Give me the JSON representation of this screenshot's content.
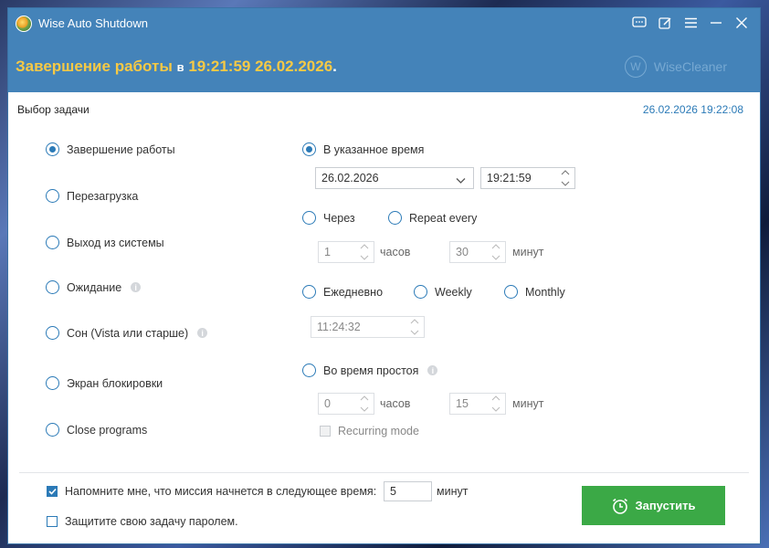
{
  "window": {
    "title": "Wise Auto Shutdown",
    "brand": "WiseCleaner",
    "brand_mark": "W"
  },
  "banner": {
    "action": "Завершение работы",
    "preposition": "в",
    "time": "19:21:59 26.02.2026",
    "period": "."
  },
  "task": {
    "section_label": "Выбор задачи",
    "current_datetime": "26.02.2026 19:22:08",
    "options": [
      {
        "label": "Завершение работы",
        "checked": true
      },
      {
        "label": "Перезагрузка",
        "checked": false
      },
      {
        "label": "Выход из системы",
        "checked": false
      },
      {
        "label": "Ожидание",
        "checked": false,
        "info": true
      },
      {
        "label": "Сон (Vista или старше)",
        "checked": false,
        "info": true
      },
      {
        "label": "Экран блокировки",
        "checked": false
      },
      {
        "label": "Close programs",
        "checked": false
      }
    ]
  },
  "schedule": {
    "specified_time_label": "В указанное время",
    "date_value": "26.02.2026",
    "time_value": "19:21:59",
    "after_label": "Через",
    "repeat_label": "Repeat every",
    "hours_value": "1",
    "hours_unit": "часов",
    "minutes_value": "30",
    "minutes_unit": "минут",
    "daily_label": "Ежедневно",
    "weekly_label": "Weekly",
    "monthly_label": "Monthly",
    "daily_time_value": "11:24:32",
    "idle_label": "Во время простоя",
    "idle_hours_value": "0",
    "idle_hours_unit": "часов",
    "idle_minutes_value": "15",
    "idle_minutes_unit": "минут",
    "recurring_label": "Recurring mode"
  },
  "footer": {
    "remind_label": "Напомните мне, что миссия начнется в следующее время:",
    "remind_value": "5",
    "remind_unit": "минут",
    "password_label": "Защитите свою задачу паролем.",
    "start_label": "Запустить"
  },
  "colors": {
    "titlebar": "#4483b9",
    "accent": "#2b7ab7",
    "banner_text": "#f6c945",
    "start_button": "#3ba946"
  }
}
